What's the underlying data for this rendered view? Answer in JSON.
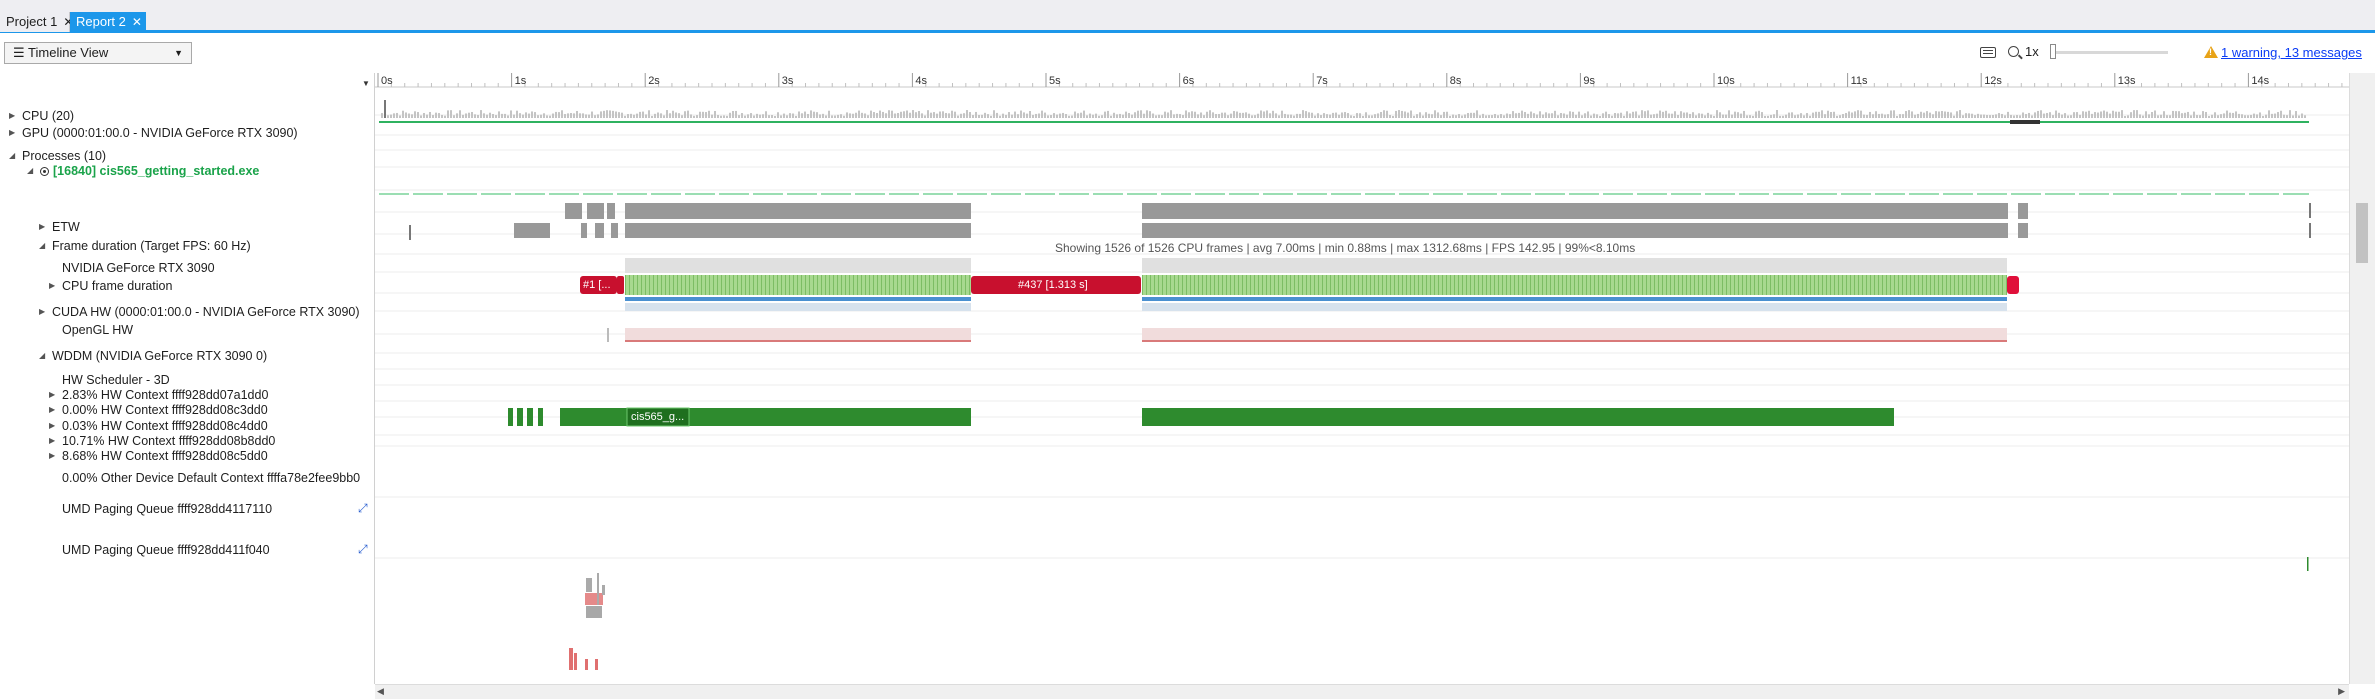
{
  "tabs": [
    {
      "label": "Project 1",
      "active": false
    },
    {
      "label": "Report 2",
      "active": true
    }
  ],
  "toolbar": {
    "view_selector": "Timeline View",
    "zoom_level": "1x",
    "warning_link": "1 warning, 13 messages"
  },
  "colors": {
    "accent": "#1c97ea",
    "process_green": "#1aa34a",
    "frame_red": "#c8102e",
    "hw_green": "#2e8b2e",
    "bar_gray": "#999999",
    "warning": "#e8a317",
    "link": "#0b3cf5"
  },
  "timeline": {
    "ruler_ticks": [
      "0s",
      "1s",
      "2s",
      "3s",
      "4s",
      "5s",
      "6s",
      "7s",
      "8s",
      "9s",
      "10s",
      "11s",
      "12s",
      "13s",
      "14s"
    ],
    "frame_summary": "Showing 1526 of 1526 CPU frames | avg 7.00ms | min 0.88ms | max 1312.68ms | FPS 142.95 | 99%<8.10ms",
    "frame_labels": [
      "#1 [...",
      "#437 [1.313 s]"
    ],
    "hw_label": "cis565_g..."
  },
  "rows": [
    {
      "label": "CPU (20)",
      "indent": 0,
      "arrow": "right"
    },
    {
      "label": "GPU (0000:01:00.0 - NVIDIA GeForce RTX 3090)",
      "indent": 0,
      "arrow": "right"
    },
    {
      "label": "Processes (10)",
      "indent": 0,
      "arrow": "down"
    },
    {
      "label": "[16840] cis565_getting_started.exe",
      "indent": 1,
      "arrow": "down",
      "process": true
    },
    {
      "label": "ETW",
      "indent": 2,
      "arrow": "right"
    },
    {
      "label": "Frame duration (Target FPS: 60 Hz)",
      "indent": 2,
      "arrow": "down"
    },
    {
      "label": "NVIDIA GeForce RTX 3090",
      "indent": 3,
      "arrow": ""
    },
    {
      "label": "CPU frame duration",
      "indent": 3,
      "arrow": "right"
    },
    {
      "label": "CUDA HW (0000:01:00.0 - NVIDIA GeForce RTX 3090)",
      "indent": 2,
      "arrow": "right"
    },
    {
      "label": "OpenGL HW",
      "indent": 3,
      "arrow": ""
    },
    {
      "label": "WDDM (NVIDIA GeForce RTX 3090 0)",
      "indent": 2,
      "arrow": "down"
    },
    {
      "label": "HW Scheduler - 3D",
      "indent": 3,
      "arrow": ""
    },
    {
      "label": "2.83% HW Context ffff928dd07a1dd0",
      "indent": 3,
      "arrow": "right"
    },
    {
      "label": "0.00% HW Context ffff928dd08c3dd0",
      "indent": 3,
      "arrow": "right"
    },
    {
      "label": "0.03% HW Context ffff928dd08c4dd0",
      "indent": 3,
      "arrow": "right"
    },
    {
      "label": "10.71% HW Context ffff928dd08b8dd0",
      "indent": 3,
      "arrow": "right"
    },
    {
      "label": "8.68% HW Context ffff928dd08c5dd0",
      "indent": 3,
      "arrow": "right"
    },
    {
      "label": "0.00% Other Device Default Context ffffa78e2fee9bb0",
      "indent": 3,
      "arrow": ""
    },
    {
      "label": "UMD Paging Queue ffff928dd4117110",
      "indent": 3,
      "arrow": "",
      "expand": true
    },
    {
      "label": "UMD Paging Queue ffff928dd411f040",
      "indent": 3,
      "arrow": "",
      "expand": true
    }
  ]
}
